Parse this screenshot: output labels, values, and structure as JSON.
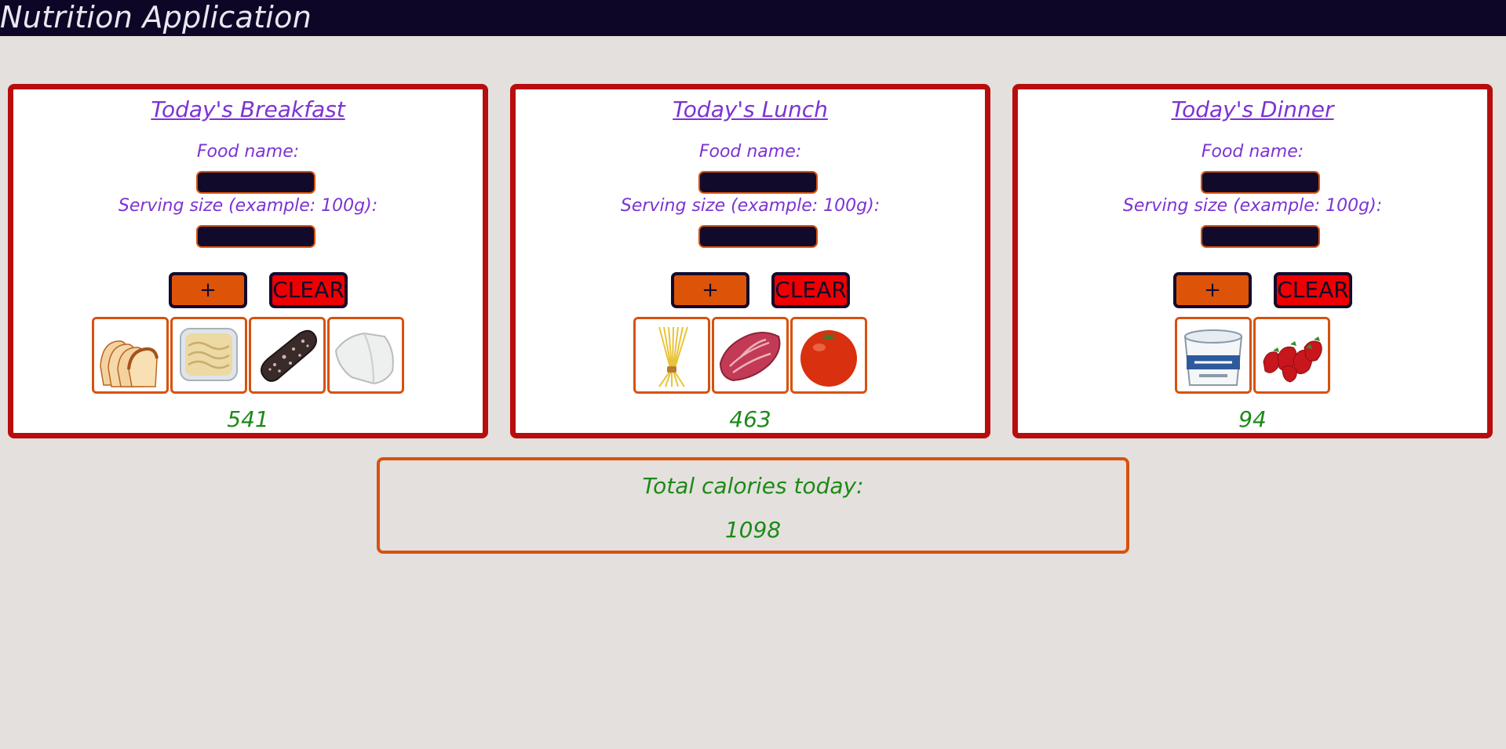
{
  "app": {
    "title": "Nutrition Application"
  },
  "labels": {
    "food_name": "Food name:",
    "serving_size": "Serving size (example: 100g):",
    "add": "+",
    "clear": "CLEAR"
  },
  "meals": [
    {
      "title": "Today's Breakfast",
      "food_value": "",
      "serving_value": "",
      "calories": "541",
      "foods": [
        "bread-slices-image",
        "butter-tub-image",
        "salami-image",
        "mozzarella-cheese-image"
      ]
    },
    {
      "title": "Today's Lunch",
      "food_value": "",
      "serving_value": "",
      "calories": "463",
      "foods": [
        "spaghetti-image",
        "steak-image",
        "tomato-image"
      ]
    },
    {
      "title": "Today's Dinner",
      "food_value": "",
      "serving_value": "",
      "calories": "94",
      "foods": [
        "soy-yogurt-cup-image",
        "strawberries-image"
      ]
    }
  ],
  "total": {
    "label": "Total calories today:",
    "value": "1098"
  },
  "colors": {
    "header_bg": "#0d0627",
    "page_bg": "#e4e0dd",
    "card_border": "#b80d0d",
    "accent_orange": "#dd5408",
    "clear_red": "#ee0000",
    "label_purple": "#7c33d4",
    "calorie_green": "#1c8a17"
  }
}
